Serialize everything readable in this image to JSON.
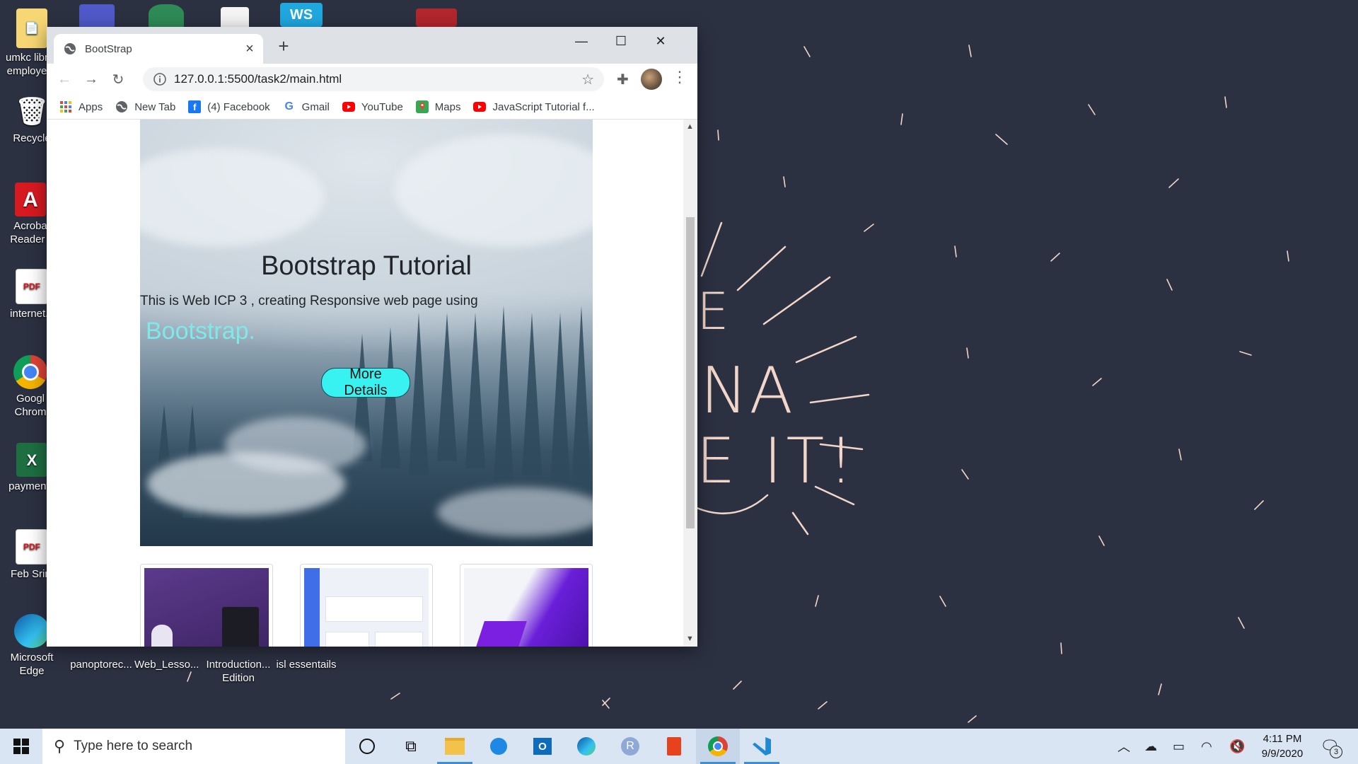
{
  "desktop": {
    "icons": [
      {
        "label": "umkc libr employe",
        "line2": ""
      },
      {
        "label": "Recycle",
        "line2": ""
      },
      {
        "label": "Acroba",
        "line2": "Reader I"
      },
      {
        "label": "internet.s",
        "line2": ""
      },
      {
        "label": "Googl",
        "line2": "Chrom"
      },
      {
        "label": "payment_",
        "line2": ""
      },
      {
        "label": "Feb Srini",
        "line2": ""
      },
      {
        "label": "Microsoft",
        "line2": "Edge"
      },
      {
        "label": "panoptorec...",
        "line2": ""
      },
      {
        "label": "Web_Lesso...",
        "line2": ""
      },
      {
        "label": "Introduction...",
        "line2": "Edition"
      },
      {
        "label": "isl essentails",
        "line2": ""
      }
    ],
    "wallpaper_text": [
      "E",
      "NA",
      "E IT!"
    ],
    "wallpaper_color": "#f2d6c9"
  },
  "browser": {
    "tab_title": "BootStrap",
    "new_tab": "+",
    "window_controls": {
      "minimize": "—",
      "maximize": "☐",
      "close": "✕"
    },
    "url": "127.0.0.1:5500/task2/main.html",
    "bookmarks": [
      {
        "label": "Apps",
        "icon": "apps-icon"
      },
      {
        "label": "New Tab",
        "icon": "globe-icon"
      },
      {
        "label": "(4) Facebook",
        "icon": "facebook-icon"
      },
      {
        "label": "Gmail",
        "icon": "google-icon"
      },
      {
        "label": "YouTube",
        "icon": "youtube-icon"
      },
      {
        "label": "Maps",
        "icon": "maps-icon"
      },
      {
        "label": "JavaScript Tutorial f...",
        "icon": "youtube-icon"
      }
    ]
  },
  "page": {
    "hero_title": "Bootstrap Tutorial",
    "hero_text": "This is Web ICP 3 , creating Responsive web page using",
    "hero_accent": "Bootstrap.",
    "hero_button": "More Details",
    "accent_color": "#37f2f0"
  },
  "taskbar": {
    "search_placeholder": "Type here to search",
    "time": "4:11 PM",
    "date": "9/9/2020",
    "notification_count": "3"
  }
}
